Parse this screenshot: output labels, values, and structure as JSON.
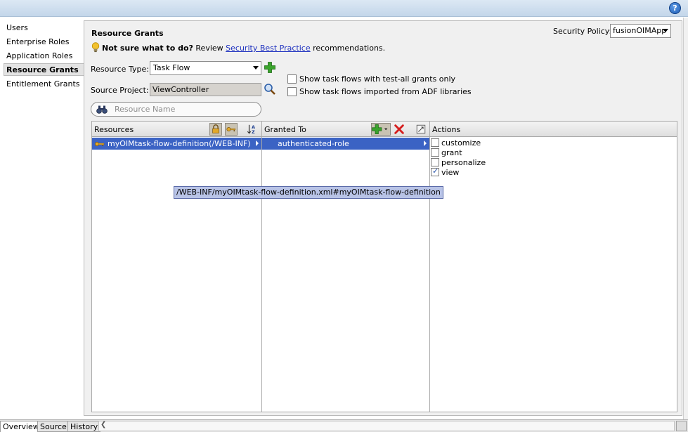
{
  "help": {
    "icon": "help-icon",
    "glyph": "?"
  },
  "nav": {
    "items": [
      {
        "label": "Users",
        "active": false
      },
      {
        "label": "Enterprise Roles",
        "active": false
      },
      {
        "label": "Application Roles",
        "active": false
      },
      {
        "label": "Resource Grants",
        "active": true
      },
      {
        "label": "Entitlement Grants",
        "active": false
      }
    ]
  },
  "panel": {
    "title": "Resource Grants",
    "hint_bold": "Not sure what to do?",
    "hint_pre": " Review ",
    "hint_link": "Security Best Practice",
    "hint_post": " recommendations.",
    "security_policy_label": "Security Policy:",
    "security_policy_value": "fusionOIMApp",
    "resource_type_label": "Resource Type:",
    "resource_type_value": "Task Flow",
    "source_project_label": "Source Project:",
    "source_project_value": "ViewController",
    "checkbox_test_all": "Show task flows with test-all grants only",
    "checkbox_adf": "Show task flows imported from ADF libraries",
    "search_placeholder": "Resource Name"
  },
  "grid": {
    "resources_header": "Resources",
    "granted_header": "Granted To",
    "actions_header": "Actions",
    "resource_row": "myOIMtask-flow-definition(/WEB-INF)",
    "granted_row": "authenticated-role",
    "actions": [
      {
        "label": "customize",
        "checked": false
      },
      {
        "label": "grant",
        "checked": false
      },
      {
        "label": "personalize",
        "checked": false
      },
      {
        "label": "view",
        "checked": true
      }
    ],
    "tooltip": "/WEB-INF/myOIMtask-flow-definition.xml#myOIMtask-flow-definition"
  },
  "bottom_tabs": [
    {
      "label": "Overview",
      "active": true
    },
    {
      "label": "Source",
      "active": false
    },
    {
      "label": "History",
      "active": false
    }
  ],
  "colors": {
    "selection": "#3b63c4",
    "link": "#1c2fbf",
    "panel_bg": "#f0f0f0"
  }
}
